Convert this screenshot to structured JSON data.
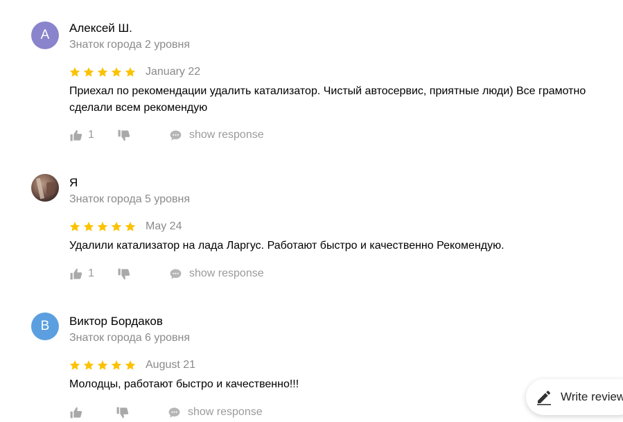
{
  "reviews": [
    {
      "avatar_letter": "A",
      "avatar_color": "#8a84cc",
      "name": "Алексей Ш.",
      "level": "Знаток города 2 уровня",
      "rating": 5,
      "date": "January 22",
      "text": "Приехал по рекомендации удалить катализатор. Чистый автосервис, приятные люди) Все грамотно сделали всем рекомендую",
      "likes": "1",
      "response_label": "show response"
    },
    {
      "avatar_letter": "",
      "avatar_color": "#5a423a",
      "name": "Я",
      "level": "Знаток города 5 уровня",
      "rating": 5,
      "date": "May 24",
      "text": "Удалили катализатор на лада Ларгус. Работают быстро и качественно Рекомендую.",
      "likes": "1",
      "response_label": "show response"
    },
    {
      "avatar_letter": "В",
      "avatar_color": "#5b9fe0",
      "name": "Виктор Бордаков",
      "level": "Знаток города 6 уровня",
      "rating": 5,
      "date": "August 21",
      "text": "Молодцы, работают быстро и качественно!!!",
      "likes": "",
      "response_label": "show response"
    }
  ],
  "write_review": {
    "label": "Write review"
  },
  "colors": {
    "star": "#fcc200",
    "muted": "#8a8a8a",
    "text": "#000000"
  }
}
